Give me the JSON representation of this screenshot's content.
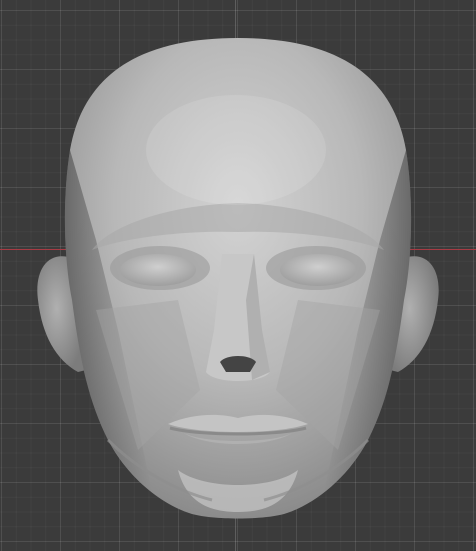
{
  "viewport": {
    "background_color": "#3b3b3b",
    "grid_color": "#555555",
    "x_axis_color": "#a83b44",
    "y_axis_color": "#666666"
  },
  "model": {
    "icon": "sculpted-head-mesh",
    "material_color": "#b9b9b9"
  }
}
